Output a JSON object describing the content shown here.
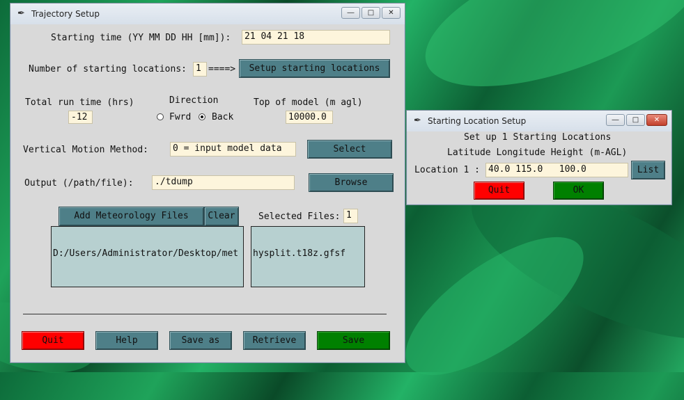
{
  "main_window": {
    "title": "Trajectory Setup",
    "starting_time_label": "Starting time (YY MM DD HH [mm]):",
    "starting_time_value": "21 04 21 18",
    "num_locations_label": "Number of starting locations:",
    "num_locations_value": "1",
    "arrow": "====>",
    "setup_locations_button": "Setup starting locations",
    "run_time_label": "Total run time (hrs)",
    "run_time_value": "-12",
    "direction_label": "Direction",
    "fwrd_label": "Fwrd",
    "back_label": "Back",
    "direction_selected": "Back",
    "top_model_label": "Top of model (m agl)",
    "top_model_value": "10000.0",
    "vertical_label": "Vertical Motion Method:",
    "vertical_value": "0 = input model data",
    "select_button": "Select",
    "output_label": "Output (/path/file):",
    "output_value": "./tdump",
    "browse_button": "Browse",
    "add_met_button": "Add Meteorology Files",
    "clear_button": "Clear",
    "selected_files_label": "Selected Files:",
    "selected_files_value": "1",
    "met_dir_list": [
      "D:/Users/Administrator/Desktop/met"
    ],
    "met_file_list": [
      "hysplit.t18z.gfsf"
    ],
    "quit_button": "Quit",
    "help_button": "Help",
    "saveas_button": "Save as",
    "retrieve_button": "Retrieve",
    "save_button": "Save"
  },
  "location_window": {
    "title": "Starting Location Setup",
    "header1": "Set up 1 Starting Locations",
    "header2": "Latitude Longitude Height (m-AGL)",
    "location_label": "Location 1 :",
    "location_value": "40.0 115.0   100.0",
    "list_button": "List",
    "quit_button": "Quit",
    "ok_button": "OK"
  },
  "colors": {
    "window_bg": "#d9d9d9",
    "entry_bg": "#fdf5dc",
    "button_teal": "#4e7f88",
    "button_red": "#ff0000",
    "button_green": "#008000",
    "listbox_bg": "#b7d0d0"
  }
}
